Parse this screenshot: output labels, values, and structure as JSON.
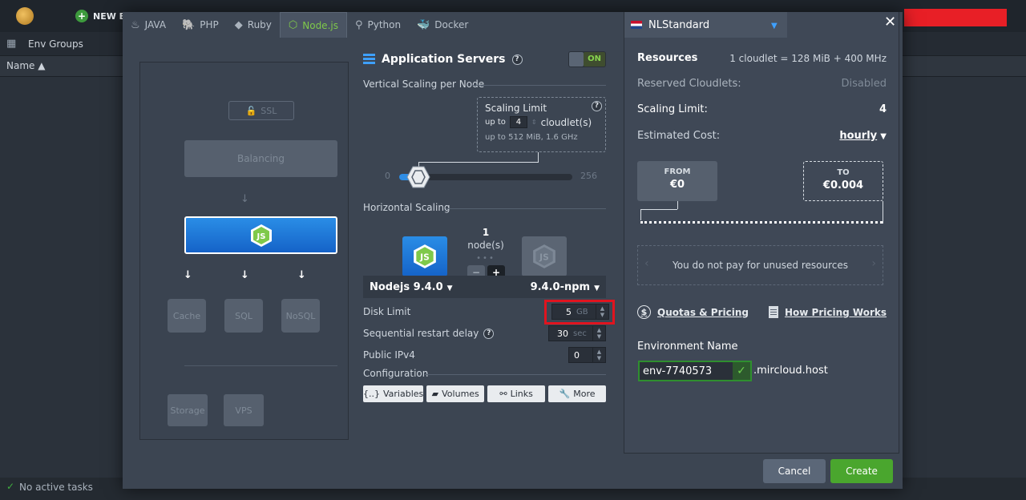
{
  "background": {
    "new_env_label": "NEW EN",
    "env_groups_label": "Env Groups",
    "name_column": "Name ▲",
    "tasks_status": "No active tasks"
  },
  "tabs": [
    {
      "label": "JAVA",
      "icon": "java-icon"
    },
    {
      "label": "PHP",
      "icon": "php-icon"
    },
    {
      "label": "Ruby",
      "icon": "ruby-icon"
    },
    {
      "label": "Node.js",
      "icon": "nodejs-icon"
    },
    {
      "label": "Python",
      "icon": "python-icon"
    },
    {
      "label": "Docker",
      "icon": "docker-icon"
    }
  ],
  "topology": {
    "ssl": "SSL",
    "balancing": "Balancing",
    "cache": "Cache",
    "sql": "SQL",
    "nosql": "NoSQL",
    "storage": "Storage",
    "vps": "VPS"
  },
  "app_servers": {
    "title": "Application Servers",
    "toggle": "ON",
    "vertical_label": "Vertical Scaling per Node",
    "scaling_limit_title": "Scaling Limit",
    "up_to": "up to",
    "cloudlets_value": "4",
    "cloudlets_unit": "cloudlet(s)",
    "up_to_2": "up to",
    "resource_caption": "512 MiB, 1.6 GHz",
    "slider_min": "0",
    "slider_max": "256",
    "slider_value": 4,
    "horizontal_label": "Horizontal Scaling",
    "node_count": "1",
    "node_label": "node(s)",
    "minus": "−",
    "plus": "+",
    "engine": "Nodejs 9.4.0",
    "version": "9.4.0-npm",
    "disk_label": "Disk Limit",
    "disk_value": "5",
    "disk_unit": "GB",
    "restart_label": "Sequential restart delay",
    "restart_value": "30",
    "restart_unit": "sec",
    "ipv4_label": "Public IPv4",
    "ipv4_value": "0",
    "config_label": "Configuration",
    "config_buttons": [
      "Variables",
      "Volumes",
      "Links",
      "More"
    ]
  },
  "right": {
    "region": "NLStandard",
    "resources_label": "Resources",
    "resources_value": "1 cloudlet = 128 MiB + 400 MHz",
    "reserved_label": "Reserved Cloudlets:",
    "reserved_value": "Disabled",
    "scaling_label": "Scaling Limit:",
    "scaling_value": "4",
    "cost_label": "Estimated Cost:",
    "cost_period": "hourly",
    "from_label": "FROM",
    "from_value": "€0",
    "to_label": "TO",
    "to_value": "€0.004",
    "unused_text": "You do not pay for unused resources",
    "quotas_link": "Quotas & Pricing",
    "pricing_link": "How Pricing Works",
    "env_name_label": "Environment Name",
    "env_name_value": "env-7740573",
    "env_domain": ".mircloud.host"
  },
  "footer": {
    "cancel": "Cancel",
    "create": "Create"
  },
  "colors": {
    "accent_blue": "#2f8de4",
    "accent_green": "#4aa62e",
    "highlight_red": "#e0141f"
  }
}
